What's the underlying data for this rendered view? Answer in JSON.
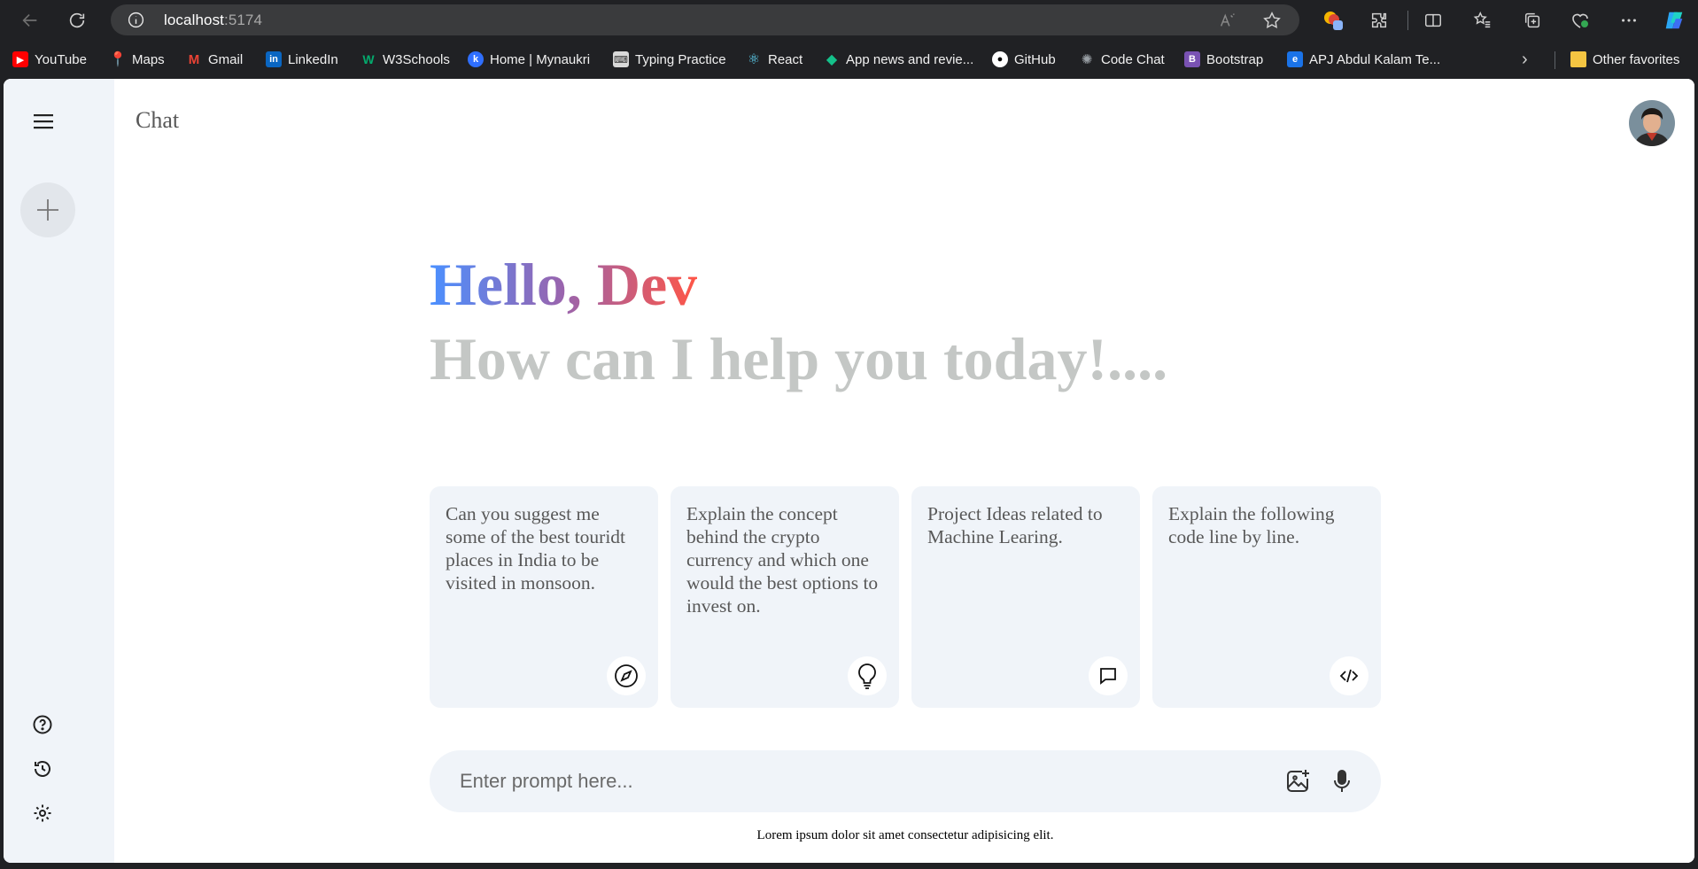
{
  "browser": {
    "url_host": "localhost",
    "url_port": ":5174",
    "bookmarks": [
      {
        "label": "YouTube",
        "color": "#ff0000"
      },
      {
        "label": "Maps",
        "color": "#34a853"
      },
      {
        "label": "Gmail",
        "color": "#ea4335"
      },
      {
        "label": "LinkedIn",
        "color": "#0a66c2"
      },
      {
        "label": "W3Schools",
        "color": "#04aa6d"
      },
      {
        "label": "Home | Mynaukri",
        "color": "#2f6fff"
      },
      {
        "label": "Typing Practice",
        "color": "#d9d9d9"
      },
      {
        "label": "React",
        "color": "#61dafb"
      },
      {
        "label": "App news and revie...",
        "color": "#14c18a"
      },
      {
        "label": "GitHub",
        "color": "#ffffff"
      },
      {
        "label": "Code Chat",
        "color": "#9aa0a6"
      },
      {
        "label": "Bootstrap",
        "color": "#7952b3"
      },
      {
        "label": "APJ Abdul Kalam Te...",
        "color": "#1a73e8"
      }
    ],
    "other_favorites": "Other favorites"
  },
  "app": {
    "title": "Chat",
    "greeting_name": "Hello, Dev",
    "greeting_sub": "How can I help you today!....",
    "cards": [
      {
        "text": "Can you suggest me some of the best touridt places in India to be visited in monsoon.",
        "icon": "compass-icon"
      },
      {
        "text": "Explain the concept behind the crypto currency and which one would the best options to invest on.",
        "icon": "bulb-icon"
      },
      {
        "text": "Project Ideas related to Machine Learing.",
        "icon": "message-icon"
      },
      {
        "text": "Explain the following code line by line.",
        "icon": "code-icon"
      }
    ],
    "prompt_placeholder": "Enter prompt here...",
    "footnote": "Lorem ipsum dolor sit amet consectetur adipisicing elit."
  },
  "colors": {
    "sidebar_bg": "#f0f4f9",
    "card_bg": "#f0f4f9",
    "gradient": [
      "#4b90ff",
      "#ff5546"
    ],
    "sub_text": "#c4c7c5"
  }
}
